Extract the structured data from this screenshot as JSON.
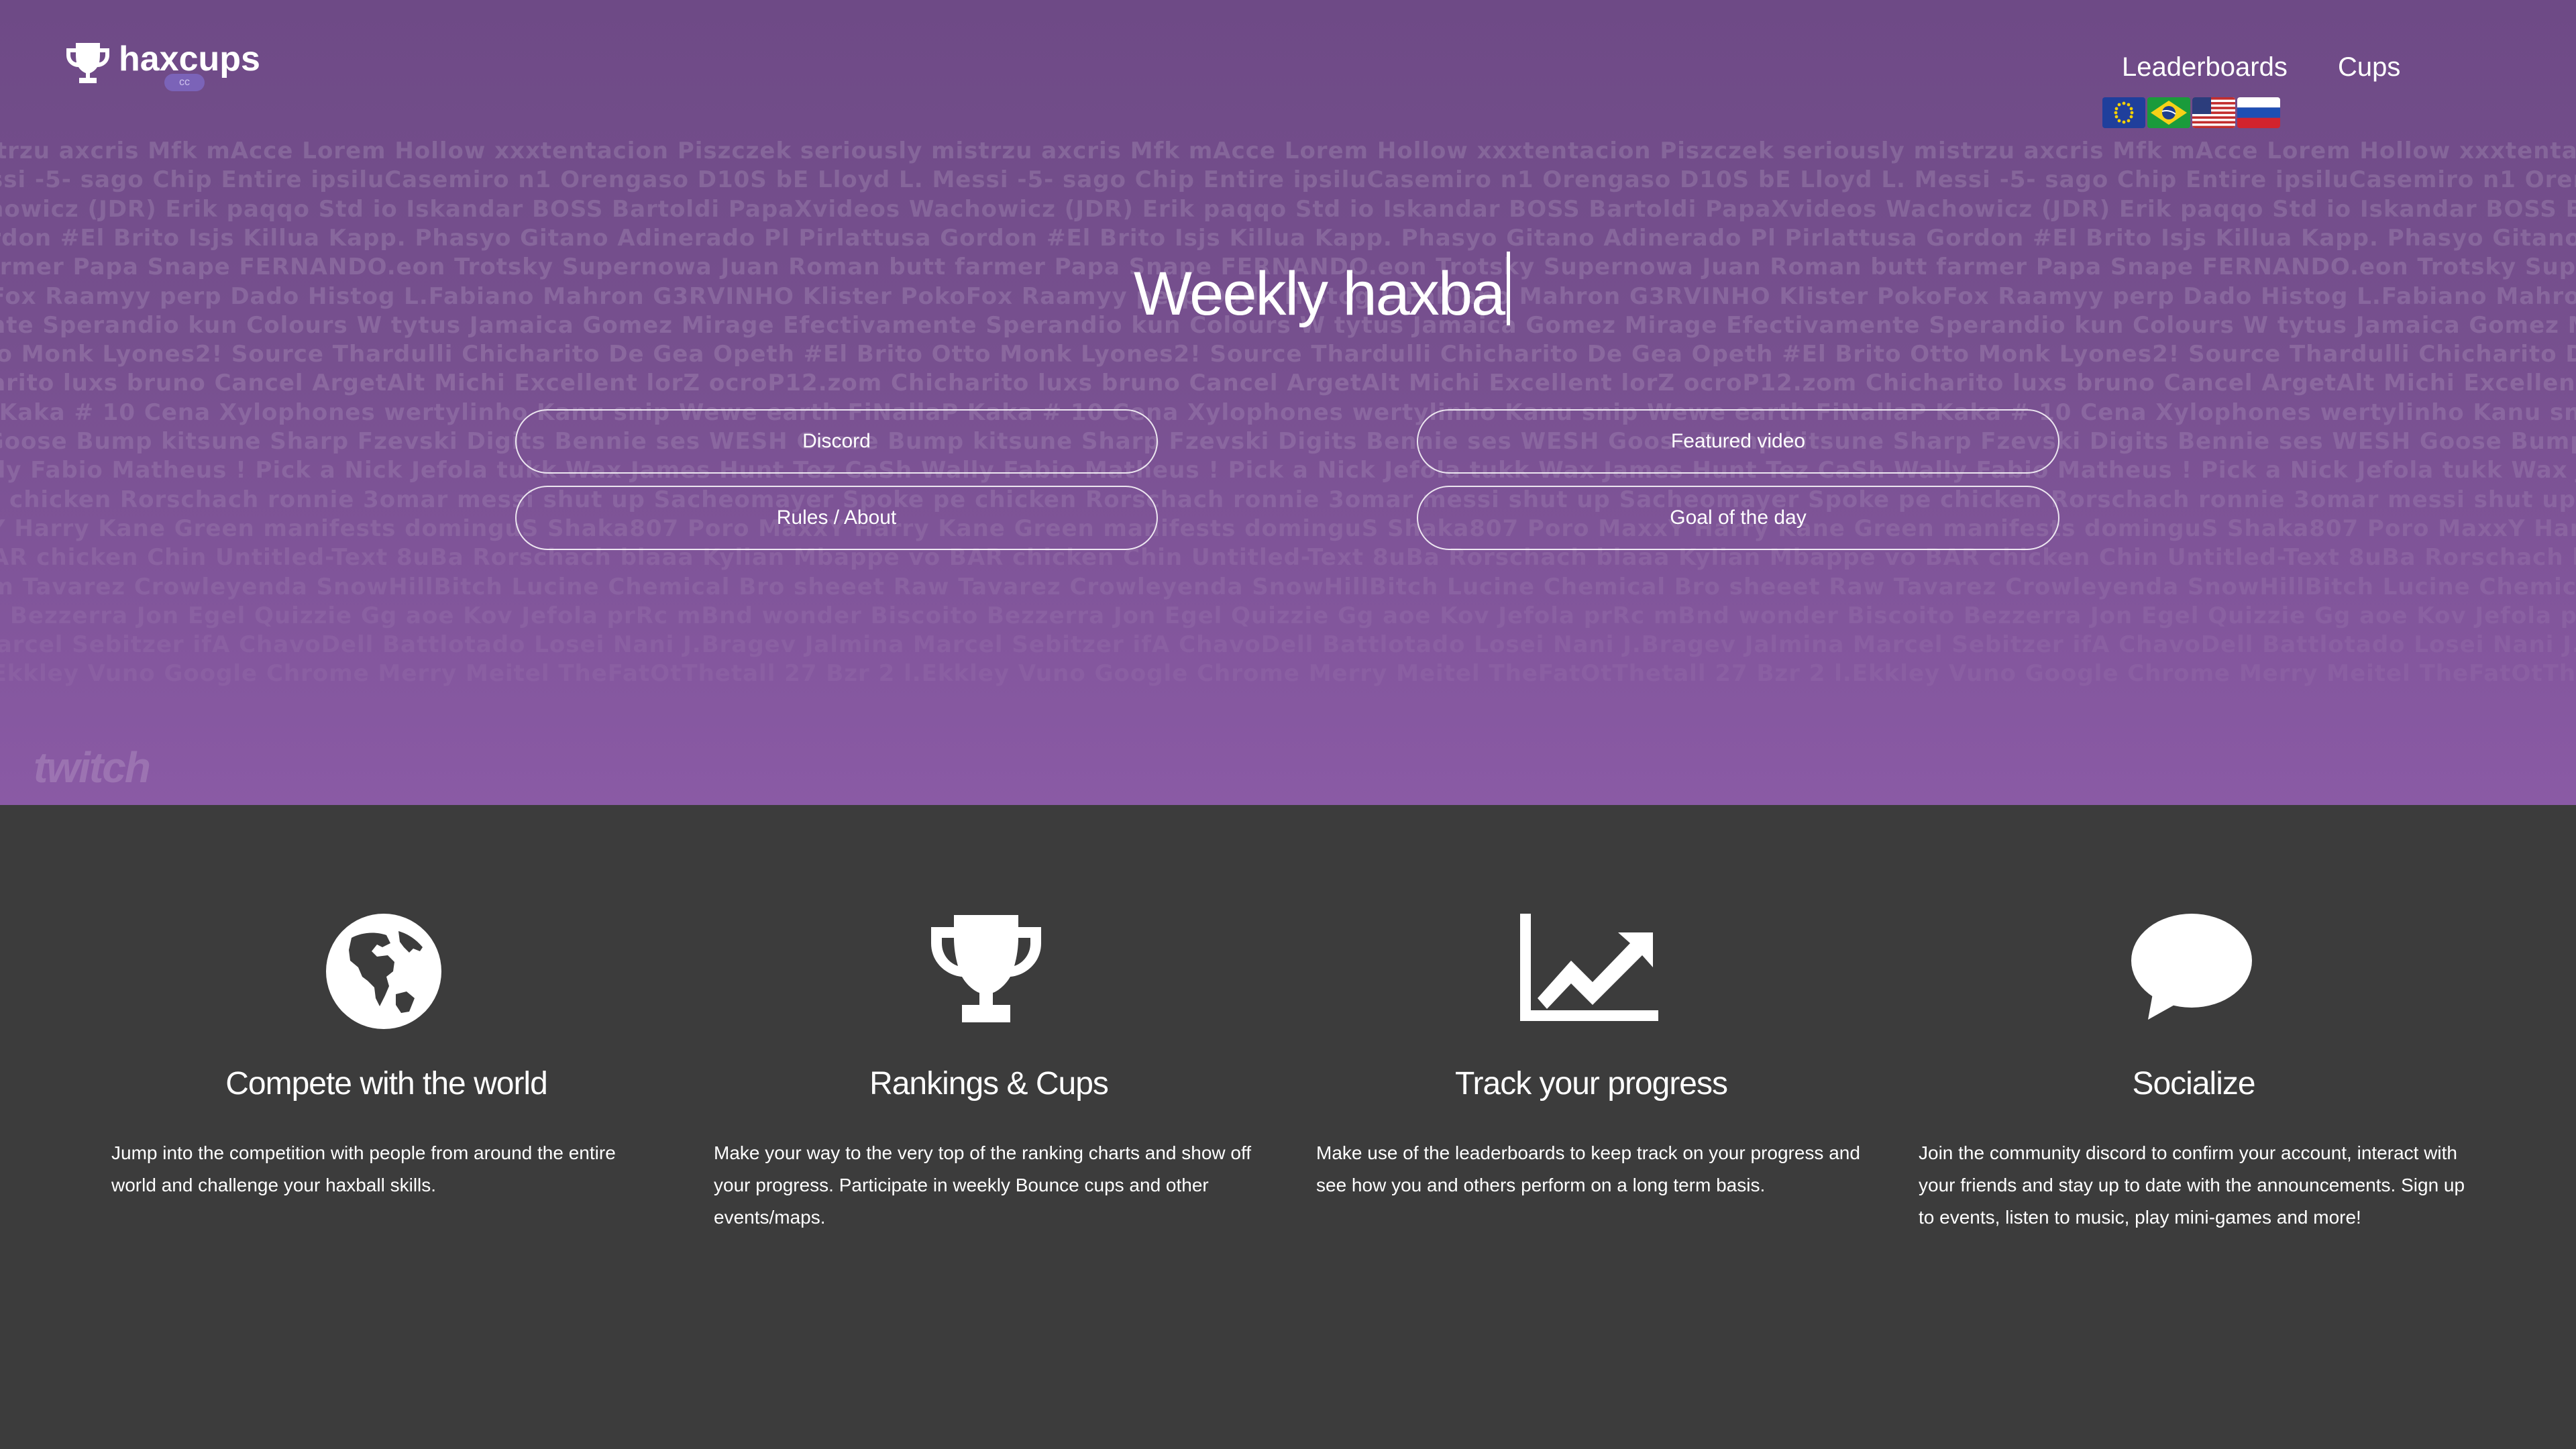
{
  "header": {
    "logo_text": "haxcups",
    "logo_badge": "cc",
    "nav": [
      "Leaderboards",
      "Cups"
    ],
    "flags": [
      "eu-flag",
      "brazil-flag",
      "usa-flag",
      "russia-flag"
    ]
  },
  "hero": {
    "title": "Weekly haxba",
    "buttons": {
      "discord": "Discord",
      "featured_video": "Featured video",
      "rules": "Rules / About",
      "goal": "Goal of the day"
    },
    "background_names": [
      "istrzu axcris Mfk mAcce Lorem Hollow xxxtentacion Piszczek seriously mistrzu axcris Mfk mAcce Lorem Hollow xxxtentacion Piszczek seriously mistrzu axcris Mfk mAcce Lorem Hollow xxxtentacion Piszczek seriously mistrz",
      "essi -5- sago Chip Entire ipsiluCasemiro n1 Orengaso D10S bE Lloyd L. Messi -5- sago Chip Entire ipsiluCasemiro n1 Orengaso D10S bE Lloyd L. Messi -5- sago Chip Entire ipsiluCasemiro n1 Orengaso D10S bE Lloyd L. Messi",
      "chowicz (JDR) Erik paqqo Std io Iskandar BOSS Bartoldi PapaXvideos Wachowicz (JDR) Erik paqqo Std io Iskandar BOSS Bartoldi PapaXvideos Wachowicz (JDR) Erik paqqo Std io Iskandar BOSS Bartoldi PapaXvideos Wachow",
      "ordon #El Brito Isjs Killua Kapp. Phasyo Gitano Adinerado Pl Pirlattusa Gordon #El Brito Isjs Killua Kapp. Phasyo Gitano Adinerado Pl Pirlattusa Gordon #El Brito Isjs Killua Kapp. Phasyo Gitano Adinerado Pl Pirlattusa Gordon",
      "farmer Papa Snape FERNANDO.eon Trotsky Supernowa Juan Roman butt farmer Papa Snape FERNANDO.eon Trotsky Supernowa Juan Roman butt farmer Papa Snape FERNANDO.eon Trotsky Supernowa Juan Roman butt farme",
      "oFox Raamyy perp Dado Histog L.Fabiano Mahron G3RVINHO Klister PokoFox Raamyy perp Dado Histog L.Fabiano Mahron G3RVINHO Klister PokoFox Raamyy perp Dado Histog L.Fabiano Mahron G3RVINHO Klister PokoFox",
      "ente Sperandio kun Colours W tytus Jamaica Gomez Mirage Efectivamente Sperandio kun Colours W tytus Jamaica Gomez Mirage Efectivamente Sperandio kun Colours W tytus Jamaica Gomez Mirage Efectivamente",
      "tto Monk Lyones2! Source Thardulli Chicharito De Gea Opeth #El Brito Otto Monk Lyones2! Source Thardulli Chicharito De Gea Opeth #El Brito Otto Monk Lyones2! Source Thardulli Chicharito De Gea Opeth #El Brito Otto Monk",
      "harito luxs bruno Cancel ArgetAlt Michi Excellent lorZ ocroP12.zom Chicharito luxs bruno Cancel ArgetAlt Michi Excellent lorZ ocroP12.zom Chicharito luxs bruno Cancel ArgetAlt Michi Excellent lorZ ocroP12.zom Chicharito",
      "P Kaka # 10 Cena Xylophones wertylinho Kanu snip Wewe earth FiNallaP Kaka # 10 Cena Xylophones wertylinho Kanu snip Wewe earth FiNallaP Kaka # 10 Cena Xylophones wertylinho Kanu snip Wewe earth FiNallaP Kaka",
      "rGoose Bump kitsune Sharp Fzevski Digits Bennie ses WESH Goose Bump kitsune Sharp Fzevski Digits Bennie ses WESH Goose Bump kitsune Sharp Fzevski Digits Bennie ses WESH Goose Bump kitsune Sharp Fzevski Digits Benni",
      "ally Fabio Matheus ! Pick a Nick Jefola tukk Wax James Hunt Tez CaSh Wally Fabio Matheus ! Pick a Nick Jefola tukk Wax James Hunt Tez CaSh Wally Fabio Matheus ! Pick a Nick Jefola tukk Wax James Hunt Tez CaSh Wally Fabio",
      "ta chicken Rorschach ronnie 3omar messi shut up Sacheomayer Spoke pe chicken Rorschach ronnie 3omar messi shut up Sacheomayer Spoke pe chicken Rorschach ronnie 3omar messi shut up Sacheomayer Spoke pe",
      "xY Harry Kane Green manifests dominguS Shaka807 Poro MaxxY Harry Kane Green manifests dominguS Shaka807 Poro MaxxY Harry Kane Green manifests dominguS Shaka807 Poro MaxxY Harry Kane Green manifests dominguS Shaka807 Poro MaxxY",
      "BAR chicken Chin Untitled-Text 8uBa Rorschach blaaa Kylian Mbappe vo BAR chicken Chin Untitled-Text 8uBa Rorschach blaaa Kylian Mbappe vo BAR chicken Chin Untitled-Text 8uBa Rorschach blaaa Kylian Mbappe vo BAR chicken",
      "om Tavarez Crowleyenda SnowHillBitch Lucine Chemical Bro sheeet Raw Tavarez Crowleyenda SnowHillBitch Lucine Chemical Bro sheeet Raw Tavarez Crowleyenda SnowHillBitch Lucine Chemical Bro sheeet Raw Tavarez",
      "ro Bezzerra Jon Egel Quizzie Gg aoe Kov Jefola prRc mBnd wonder Biscoito Bezzerra Jon Egel Quizzie Gg aoe Kov Jefola prRc mBnd wonder Biscoito Bezzerra Jon Egel Quizzie Gg aoe Kov Jefola prRc mBnd wonder Biscoito",
      "Marcel Sebitzer ifA ChavoDell Battlotado Losei Nani J.Bragev Jalmina Marcel Sebitzer ifA ChavoDell Battlotado Losei Nani J.Bragev Jalmina Marcel Sebitzer ifA ChavoDell Battlotado Losei Nani J.Bragev Jalmina",
      "l.Ekkley Vuno Google Chrome Merry Meitel TheFatOtThetall 27 Bzr 2 l.Ekkley Vuno Google Chrome Merry Meitel TheFatOtThetall 27 Bzr 2 l.Ekkley Vuno Google Chrome Merry Meitel TheFatOtThetall 27 Bzr 2 l.Ekkley"
    ]
  },
  "twitch": {
    "label": "twitch"
  },
  "features": [
    {
      "icon": "globe-icon",
      "title": "Compete with the world",
      "description": "Jump into the competition with people from around the entire world and challenge your haxball skills."
    },
    {
      "icon": "trophy-icon",
      "title": "Rankings & Cups",
      "description": "Make your way to the very top of the ranking charts and show off your progress. Participate in weekly Bounce cups and other events/maps."
    },
    {
      "icon": "chart-icon",
      "title": "Track your progress",
      "description": "Make use of the leaderboards to keep track on your progress and see how you and others perform on a long term basis."
    },
    {
      "icon": "speech-bubble-icon",
      "title": "Socialize",
      "description": "Join the community discord to confirm your account, interact with your friends and stay up to date with the announcements. Sign up to events, listen to music, play mini-games and more!"
    }
  ],
  "colors": {
    "hero_top": "#6e4a86",
    "hero_bottom": "#8a5aa5",
    "section_bg": "#3c3c3c",
    "text": "#ffffff"
  }
}
